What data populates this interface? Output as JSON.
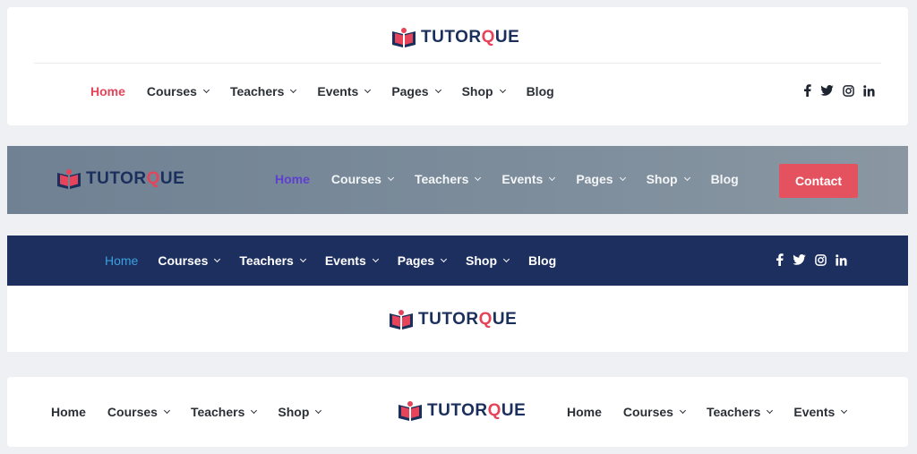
{
  "brand": {
    "name_part1": "TUTOR",
    "name_o": "Q",
    "name_part2": "UE",
    "colors": {
      "navy": "#1b2f5c",
      "red": "#e5445a"
    }
  },
  "header1": {
    "nav": [
      {
        "label": "Home",
        "active": true,
        "dropdown": false
      },
      {
        "label": "Courses",
        "dropdown": true
      },
      {
        "label": "Teachers",
        "dropdown": true
      },
      {
        "label": "Events",
        "dropdown": true
      },
      {
        "label": "Pages",
        "dropdown": true
      },
      {
        "label": "Shop",
        "dropdown": true
      },
      {
        "label": "Blog",
        "dropdown": false
      }
    ],
    "socials": [
      "facebook-icon",
      "twitter-icon",
      "instagram-icon",
      "linkedin-icon"
    ]
  },
  "header2": {
    "nav": [
      {
        "label": "Home",
        "active": true
      },
      {
        "label": "Courses"
      },
      {
        "label": "Teachers"
      },
      {
        "label": "Events"
      },
      {
        "label": "Pages"
      },
      {
        "label": "Shop"
      },
      {
        "label": "Blog"
      }
    ],
    "contact_label": "Contact",
    "accent": "#e5525f"
  },
  "header3": {
    "nav": [
      {
        "label": "Home",
        "active": true
      },
      {
        "label": "Courses"
      },
      {
        "label": "Teachers"
      },
      {
        "label": "Events"
      },
      {
        "label": "Pages"
      },
      {
        "label": "Shop"
      },
      {
        "label": "Blog"
      }
    ],
    "bar_color": "#1d2f5f"
  },
  "header4": {
    "nav_left": [
      {
        "label": "Home"
      },
      {
        "label": "Courses"
      },
      {
        "label": "Teachers"
      },
      {
        "label": "Shop"
      }
    ],
    "nav_right": [
      {
        "label": "Home"
      },
      {
        "label": "Courses"
      },
      {
        "label": "Teachers"
      },
      {
        "label": "Events"
      }
    ]
  }
}
